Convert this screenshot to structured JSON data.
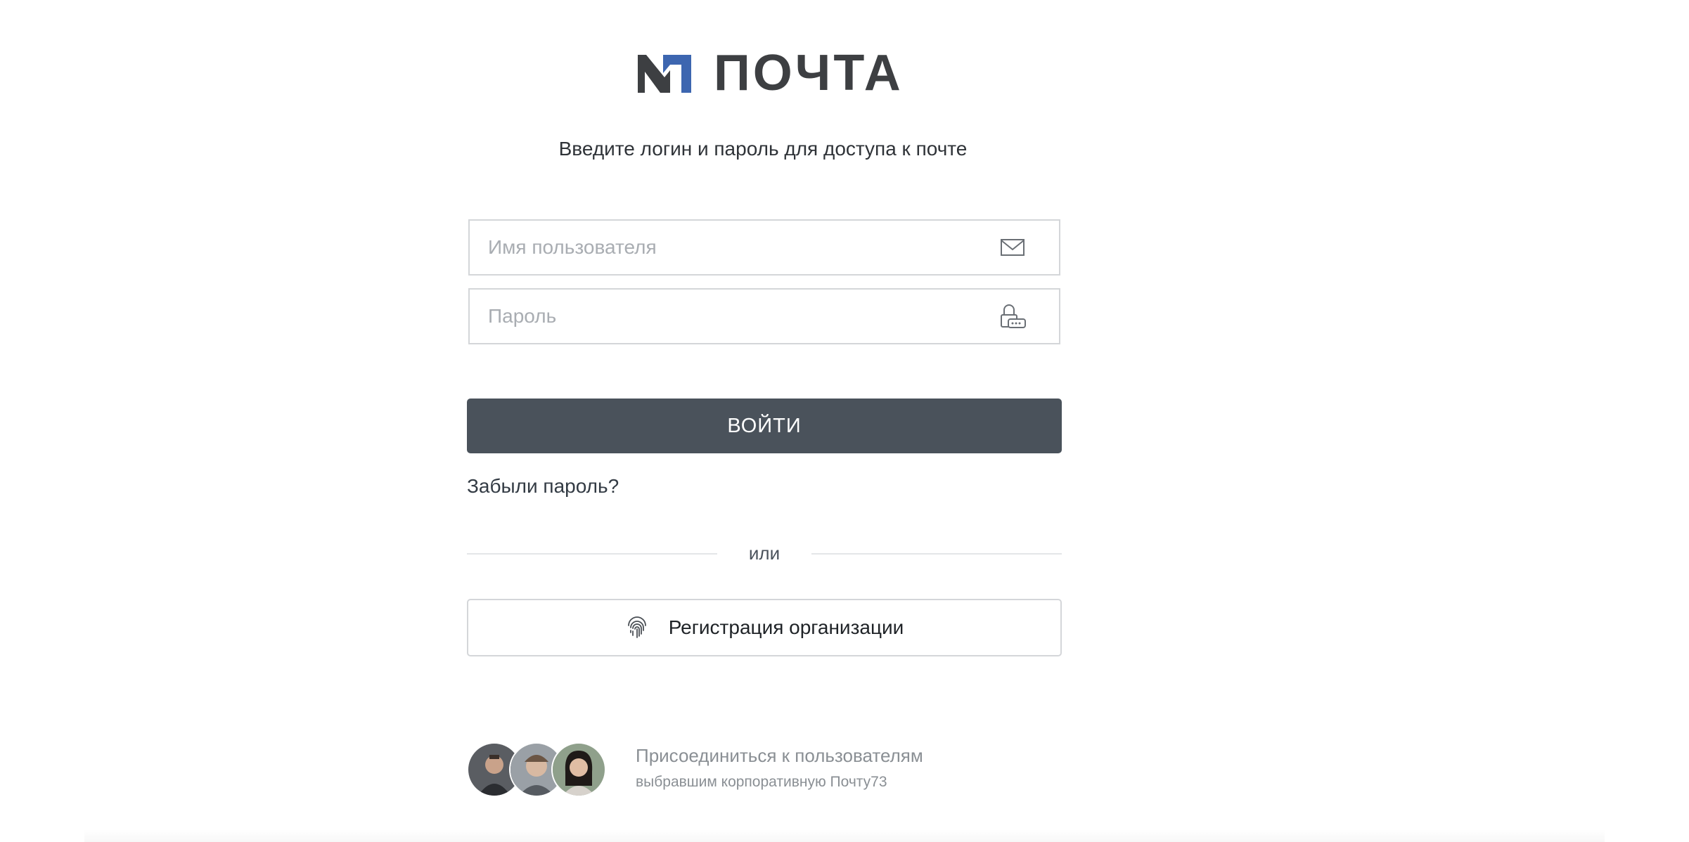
{
  "logo": {
    "text": "ПОЧТА",
    "accent_color": "#3d66b0",
    "mark_color": "#3d3f42"
  },
  "subtitle": "Введите логин и пароль для доступа к почте",
  "form": {
    "username_placeholder": "Имя пользователя",
    "username_value": "",
    "password_placeholder": "Пароль",
    "password_value": "",
    "username_icon": "envelope-icon",
    "password_icon": "lock-keyboard-icon"
  },
  "login_button": {
    "label": "ВОЙТИ",
    "color": "#4a525b"
  },
  "forgot_link": "Забыли пароль?",
  "divider_text": "или",
  "register": {
    "label": "Регистрация организации",
    "icon": "fingerprint-icon"
  },
  "promo": {
    "title": "Присоединиться к пользователям",
    "subtitle": "выбравшим корпоративную Почту73",
    "avatar_count": 3
  }
}
